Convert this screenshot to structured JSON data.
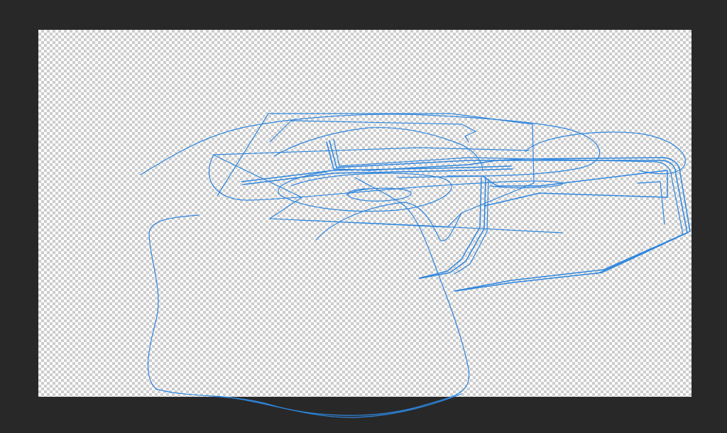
{
  "app": {
    "view": "drawing-canvas"
  },
  "colors": {
    "workspace_background": "#282828",
    "transparency_checker_light": "#ffffff",
    "transparency_checker_dark": "#cccccc",
    "stroke": "#2e86de"
  },
  "canvas": {
    "background": "transparent-checkerboard",
    "stroke_count": 22
  }
}
